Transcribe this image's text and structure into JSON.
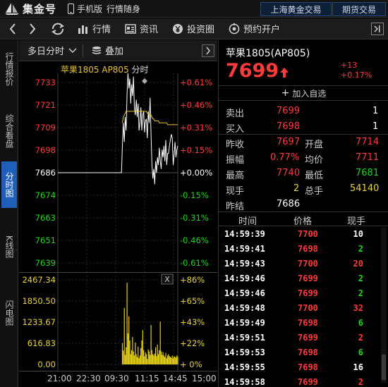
{
  "topbar": {
    "logo_text": "集金号",
    "mobile_label": "手机版",
    "slogan": "行情随身",
    "tabs": [
      "上海黄金交易",
      "期货交易"
    ]
  },
  "nav": {
    "items": [
      {
        "label": "行情",
        "icon": "chart-bars-icon"
      },
      {
        "label": "资讯",
        "icon": "news-icon"
      },
      {
        "label": "投资圈",
        "icon": "yen-coin-icon"
      },
      {
        "label": "预约开户",
        "icon": "appointment-icon"
      }
    ]
  },
  "sidebar": {
    "items": [
      "行情报价",
      "综合看盘",
      "分时图",
      "K线图",
      "闪电图"
    ],
    "active": "分时图"
  },
  "chart": {
    "period_label": "多日分时",
    "overlay_label": "叠加",
    "legend_name": "苹果1805 AP805",
    "legend_type": "分时",
    "price_axis_left": [
      "7733",
      "7721",
      "7709",
      "7698",
      "7686",
      "7674",
      "7663",
      "7651",
      "7639"
    ],
    "price_axis_right": [
      "+0.61%",
      "+0.46%",
      "+0.31%",
      "+0.15%",
      "+0.00%",
      "-0.15%",
      "-0.31%",
      "-0.46%",
      "-0.61%"
    ],
    "vol_axis_left": [
      "2467.34",
      "1850.50",
      "1233.67",
      "616.83",
      "0.00"
    ],
    "vol_axis_right": [
      "+86%",
      "+65%",
      "+43%",
      "+22%",
      "+ 0%"
    ],
    "vol_close_label": "X",
    "time_labels": [
      "21:00",
      "22:30",
      "09:30",
      "11:15",
      "14:45",
      "15:00"
    ]
  },
  "chart_data": {
    "type": "line",
    "title": "苹果1805 AP805 分时",
    "base_price": 7686,
    "ylim": [
      7639,
      7733
    ],
    "series": [
      {
        "name": "价格",
        "values": [
          7686,
          7686,
          7686,
          7686,
          7686,
          7686,
          7686,
          7686,
          7686,
          7686,
          7686,
          7686,
          7686,
          7686,
          7686,
          7686,
          7686,
          7686,
          7686,
          7686,
          7686,
          7686,
          7686,
          7686,
          7686,
          7686,
          7686,
          7686,
          7686,
          7686,
          7686,
          7686,
          7686,
          7686,
          7686,
          7686,
          7686,
          7686,
          7686,
          7686,
          7686,
          7686,
          7686,
          7686,
          7686,
          7686,
          7686,
          7686,
          7686,
          7686,
          7686,
          7686,
          7686,
          7686,
          7686,
          7686,
          7686,
          7686,
          7686,
          7686,
          7686,
          7686,
          7686,
          7686,
          7686,
          7686,
          7686,
          7686,
          7686,
          7686,
          7700,
          7712,
          7702,
          7715,
          7708,
          7727,
          7738,
          7730,
          7735,
          7722,
          7732,
          7726,
          7736,
          7720,
          7716,
          7724,
          7715,
          7722,
          7708,
          7712,
          7720,
          7708,
          7716,
          7718,
          7707,
          7713,
          7714,
          7704,
          7718,
          7712,
          7725,
          7706,
          7690,
          7683,
          7688,
          7680,
          7692,
          7686,
          7694,
          7690,
          7699,
          7692,
          7688,
          7698,
          7694,
          7700,
          7692,
          7703,
          7690,
          7696,
          7696,
          7700,
          7703,
          7706,
          7704,
          7690,
          7695,
          7702,
          7694,
          7698,
          7700
        ]
      },
      {
        "name": "均价",
        "values": [
          null,
          null,
          null,
          null,
          null,
          null,
          null,
          null,
          null,
          null,
          null,
          null,
          null,
          null,
          null,
          null,
          null,
          null,
          null,
          null,
          null,
          null,
          null,
          null,
          null,
          null,
          null,
          null,
          null,
          null,
          null,
          null,
          null,
          null,
          null,
          null,
          null,
          null,
          null,
          null,
          null,
          null,
          null,
          null,
          null,
          null,
          null,
          null,
          null,
          null,
          null,
          null,
          null,
          null,
          null,
          null,
          null,
          null,
          null,
          null,
          null,
          null,
          null,
          null,
          null,
          null,
          null,
          null,
          null,
          null,
          7712,
          7715,
          7716,
          7717,
          7718,
          7718,
          7718,
          7718,
          7718,
          7718,
          7718,
          7718,
          7718,
          7718,
          7718,
          7718,
          7718,
          7718,
          7718,
          7718,
          7718,
          7718,
          7718,
          7718,
          7718,
          7718,
          7718,
          7717,
          7717,
          7716,
          7716,
          7716,
          7715,
          7714,
          7714,
          7713,
          7713,
          7713,
          7713,
          7713,
          7712,
          7712,
          7712,
          7712,
          7712,
          7712,
          7712,
          7712,
          7712,
          7711,
          7711,
          7711,
          7711,
          7711,
          7711,
          7711,
          7711,
          7711,
          7711,
          7711,
          7711
        ]
      }
    ],
    "volume": {
      "ylim": [
        0,
        2467.34
      ],
      "values": [
        0,
        0,
        0,
        0,
        0,
        0,
        0,
        0,
        0,
        0,
        0,
        0,
        0,
        0,
        0,
        0,
        0,
        0,
        0,
        0,
        0,
        0,
        0,
        0,
        0,
        0,
        0,
        0,
        0,
        0,
        0,
        0,
        0,
        0,
        0,
        0,
        0,
        0,
        0,
        0,
        0,
        0,
        0,
        0,
        0,
        0,
        0,
        0,
        0,
        0,
        0,
        0,
        0,
        0,
        0,
        0,
        0,
        0,
        0,
        0,
        0,
        0,
        0,
        0,
        0,
        0,
        0,
        0,
        0,
        0,
        620,
        400,
        1650,
        280,
        500,
        2380,
        900,
        1400,
        700,
        300,
        420,
        800,
        380,
        260,
        640,
        300,
        220,
        520,
        180,
        260,
        480,
        700,
        1000,
        420,
        240,
        360,
        300,
        160,
        440,
        380,
        280,
        1150,
        420,
        300,
        260,
        320,
        500,
        240,
        580,
        300,
        420,
        1250,
        380,
        280,
        360,
        260,
        220,
        340,
        180,
        260,
        300,
        240,
        220,
        200,
        260,
        180,
        240,
        220,
        200,
        260,
        220
      ]
    },
    "time_labels": [
      "21:00",
      "22:30",
      "09:30",
      "11:15",
      "14:45",
      "15:00"
    ]
  },
  "quote": {
    "name": "苹果1805",
    "code": "(AP805)",
    "price": "7699",
    "change": "+13",
    "change_pct": "+0.17%",
    "watch_label": "加入自选",
    "sell_label": "卖出",
    "sell_price": "7699",
    "sell_vol": "1",
    "buy_label": "买入",
    "buy_price": "7698",
    "buy_vol": "1",
    "fields": {
      "prev_close_label": "昨收",
      "prev_close": "7697",
      "open_label": "开盘",
      "open": "7714",
      "amplitude_label": "振幅",
      "amplitude": "0.77%",
      "avg_label": "均价",
      "avg": "7711",
      "high_label": "最高",
      "high": "7740",
      "low_label": "最低",
      "low": "7681",
      "last_vol_label": "现手",
      "last_vol": "2",
      "total_vol_label": "总手",
      "total_vol": "54140",
      "settle_label": "昨结",
      "settle": "7686"
    }
  },
  "ticks": {
    "headers": [
      "时间",
      "价格",
      "现手"
    ],
    "rows": [
      {
        "time": "14:59:39",
        "price": "7700",
        "vol": "10",
        "pc": "red",
        "vc": "white"
      },
      {
        "time": "14:59:41",
        "price": "7698",
        "vol": "2",
        "pc": "red",
        "vc": "green"
      },
      {
        "time": "14:59:43",
        "price": "7700",
        "vol": "20",
        "pc": "red",
        "vc": "red"
      },
      {
        "time": "14:59:46",
        "price": "7699",
        "vol": "2",
        "pc": "red",
        "vc": "green"
      },
      {
        "time": "14:59:46",
        "price": "7699",
        "vol": "2",
        "pc": "red",
        "vc": "green"
      },
      {
        "time": "14:59:48",
        "price": "7700",
        "vol": "32",
        "pc": "red",
        "vc": "red"
      },
      {
        "time": "14:59:49",
        "price": "7698",
        "vol": "6",
        "pc": "red",
        "vc": "green"
      },
      {
        "time": "14:59:51",
        "price": "7699",
        "vol": "2",
        "pc": "red",
        "vc": "red"
      },
      {
        "time": "14:59:53",
        "price": "7698",
        "vol": "6",
        "pc": "red",
        "vc": "green"
      },
      {
        "time": "14:59:55",
        "price": "7698",
        "vol": "16",
        "pc": "red",
        "vc": "white"
      },
      {
        "time": "14:59:58",
        "price": "7699",
        "vol": "2",
        "pc": "red",
        "vc": "red"
      }
    ]
  },
  "colors": {
    "up": "#ff3b3b",
    "down": "#22d322",
    "price_line": "#ffffff",
    "avg_line": "#e7c43b",
    "volume": "#e7d21a",
    "active_tab": "#1e5fb8"
  }
}
